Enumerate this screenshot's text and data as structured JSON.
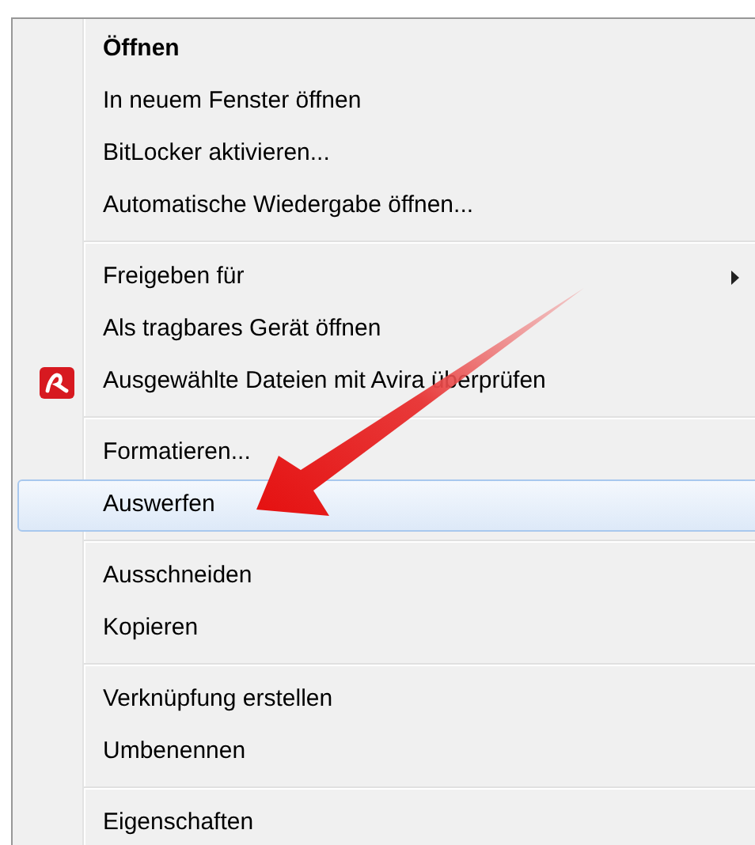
{
  "menu": {
    "groups": [
      {
        "items": [
          {
            "label": "Öffnen",
            "default": true,
            "selected": false,
            "submenu": false,
            "has_icon": false
          },
          {
            "label": "In neuem Fenster öffnen",
            "default": false,
            "selected": false,
            "submenu": false,
            "has_icon": false
          },
          {
            "label": "BitLocker aktivieren...",
            "default": false,
            "selected": false,
            "submenu": false,
            "has_icon": false
          },
          {
            "label": "Automatische Wiedergabe öffnen...",
            "default": false,
            "selected": false,
            "submenu": false,
            "has_icon": false
          }
        ]
      },
      {
        "items": [
          {
            "label": "Freigeben für",
            "default": false,
            "selected": false,
            "submenu": true,
            "has_icon": false
          },
          {
            "label": "Als tragbares Gerät öffnen",
            "default": false,
            "selected": false,
            "submenu": false,
            "has_icon": false
          },
          {
            "label": "Ausgewählte Dateien mit Avira überprüfen",
            "default": false,
            "selected": false,
            "submenu": false,
            "has_icon": true
          }
        ]
      },
      {
        "items": [
          {
            "label": "Formatieren...",
            "default": false,
            "selected": false,
            "submenu": false,
            "has_icon": false
          },
          {
            "label": "Auswerfen",
            "default": false,
            "selected": true,
            "submenu": false,
            "has_icon": false
          }
        ]
      },
      {
        "items": [
          {
            "label": "Ausschneiden",
            "default": false,
            "selected": false,
            "submenu": false,
            "has_icon": false
          },
          {
            "label": "Kopieren",
            "default": false,
            "selected": false,
            "submenu": false,
            "has_icon": false
          }
        ]
      },
      {
        "items": [
          {
            "label": "Verknüpfung erstellen",
            "default": false,
            "selected": false,
            "submenu": false,
            "has_icon": false
          },
          {
            "label": "Umbenennen",
            "default": false,
            "selected": false,
            "submenu": false,
            "has_icon": false
          }
        ]
      },
      {
        "items": [
          {
            "label": "Eigenschaften",
            "default": false,
            "selected": false,
            "submenu": false,
            "has_icon": false
          }
        ]
      }
    ]
  }
}
